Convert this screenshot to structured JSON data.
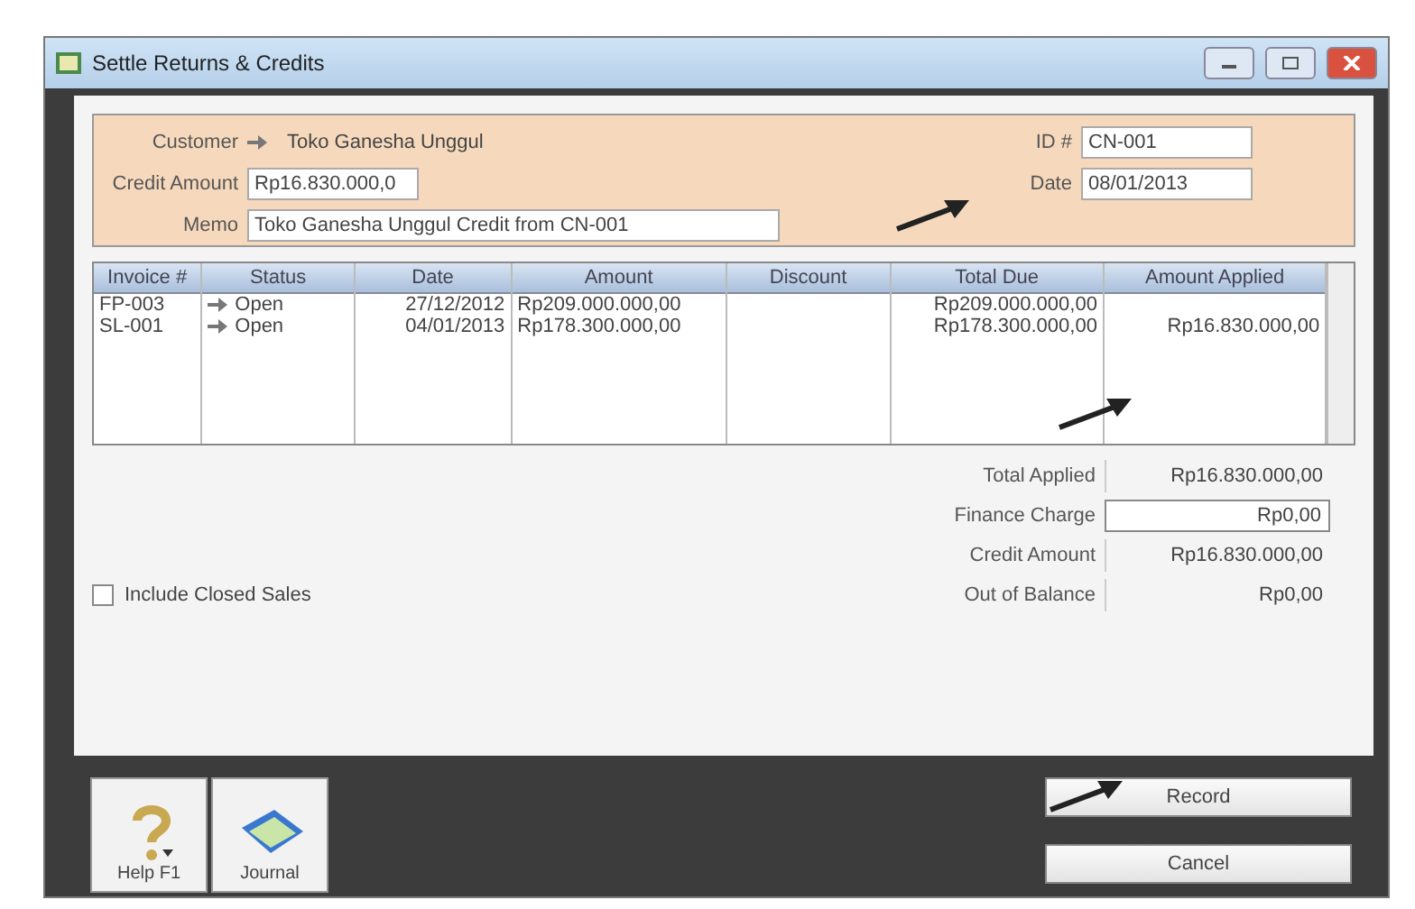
{
  "window": {
    "title": "Settle Returns & Credits"
  },
  "header": {
    "customer_label": "Customer",
    "customer": "Toko Ganesha Unggul",
    "credit_amount_label": "Credit Amount",
    "credit_amount": "Rp16.830.000,0",
    "memo_label": "Memo",
    "memo": "Toko Ganesha Unggul  Credit from CN-001",
    "id_label": "ID #",
    "id": "CN-001",
    "date_label": "Date",
    "date": "08/01/2013"
  },
  "table": {
    "columns": [
      "Invoice #",
      "Status",
      "Date",
      "Amount",
      "Discount",
      "Total Due",
      "Amount Applied"
    ],
    "rows": [
      {
        "invoice": "FP-003",
        "status": "Open",
        "date": "27/12/2012",
        "amount": "Rp209.000.000,00",
        "discount": "",
        "total_due": "Rp209.000.000,00",
        "applied": ""
      },
      {
        "invoice": "SL-001",
        "status": "Open",
        "date": "04/01/2013",
        "amount": "Rp178.300.000,00",
        "discount": "",
        "total_due": "Rp178.300.000,00",
        "applied": "Rp16.830.000,00"
      }
    ]
  },
  "include_closed_sales": {
    "label": "Include Closed Sales",
    "checked": false
  },
  "totals": [
    {
      "label": "Total Applied",
      "value": "Rp16.830.000,00",
      "editable": false
    },
    {
      "label": "Finance Charge",
      "value": "Rp0,00",
      "editable": true
    },
    {
      "label": "Credit Amount",
      "value": "Rp16.830.000,00",
      "editable": false
    },
    {
      "label": "Out of Balance",
      "value": "Rp0,00",
      "editable": false
    }
  ],
  "toolbar": [
    {
      "kind": "help",
      "label": "Help F1"
    },
    {
      "kind": "journal",
      "label": "Journal"
    }
  ],
  "buttons": [
    "Record",
    "Cancel"
  ]
}
